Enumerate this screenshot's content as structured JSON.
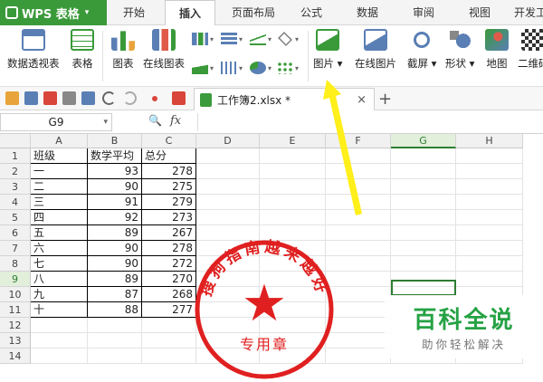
{
  "app": {
    "title": "WPS 表格",
    "dropdown": "▾"
  },
  "tabs": [
    {
      "label": "开始"
    },
    {
      "label": "插入"
    },
    {
      "label": "页面布局"
    },
    {
      "label": "公式"
    },
    {
      "label": "数据"
    },
    {
      "label": "审阅"
    },
    {
      "label": "视图"
    },
    {
      "label": "开发工"
    }
  ],
  "active_tab": "插入",
  "ribbon": {
    "pivot": "数据透视表",
    "table": "表格",
    "chart": "图表",
    "online_chart": "在线图表",
    "picture": "图片",
    "online_picture": "在线图片",
    "screenshot": "截屏",
    "shapes": "形状",
    "map": "地图",
    "qrcode": "二维码",
    "dd": "▾"
  },
  "document": {
    "tab_name": "工作簿2.xlsx *",
    "close": "×",
    "new_tab": "+"
  },
  "formula_bar": {
    "name_box": "G9",
    "dd": "▾",
    "zoom_glyph": "🔍",
    "fx": "fx"
  },
  "columns": [
    "A",
    "B",
    "C",
    "D",
    "E",
    "F",
    "G",
    "H"
  ],
  "rows": [
    "1",
    "2",
    "3",
    "4",
    "5",
    "6",
    "7",
    "8",
    "9",
    "10",
    "11",
    "12",
    "13",
    "14"
  ],
  "table": {
    "headers": [
      "班级",
      "数学平均",
      "总分"
    ],
    "data": [
      [
        "一",
        "93",
        "278"
      ],
      [
        "二",
        "90",
        "275"
      ],
      [
        "三",
        "91",
        "279"
      ],
      [
        "四",
        "92",
        "273"
      ],
      [
        "五",
        "89",
        "267"
      ],
      [
        "六",
        "90",
        "278"
      ],
      [
        "七",
        "90",
        "272"
      ],
      [
        "八",
        "89",
        "270"
      ],
      [
        "九",
        "87",
        "268"
      ],
      [
        "十",
        "88",
        "277"
      ]
    ]
  },
  "selected_cell": "G9",
  "stamp": {
    "ring_text": "搜狗指南越来越好",
    "center_text": "专用章",
    "star": "★"
  },
  "watermark": {
    "title": "百科全说",
    "subtitle": "助你轻松解决"
  },
  "colors": {
    "brand": "#3a9a3a",
    "selection": "#2e7d32",
    "stamp": "#e02020",
    "arrow": "#ffef1a"
  }
}
